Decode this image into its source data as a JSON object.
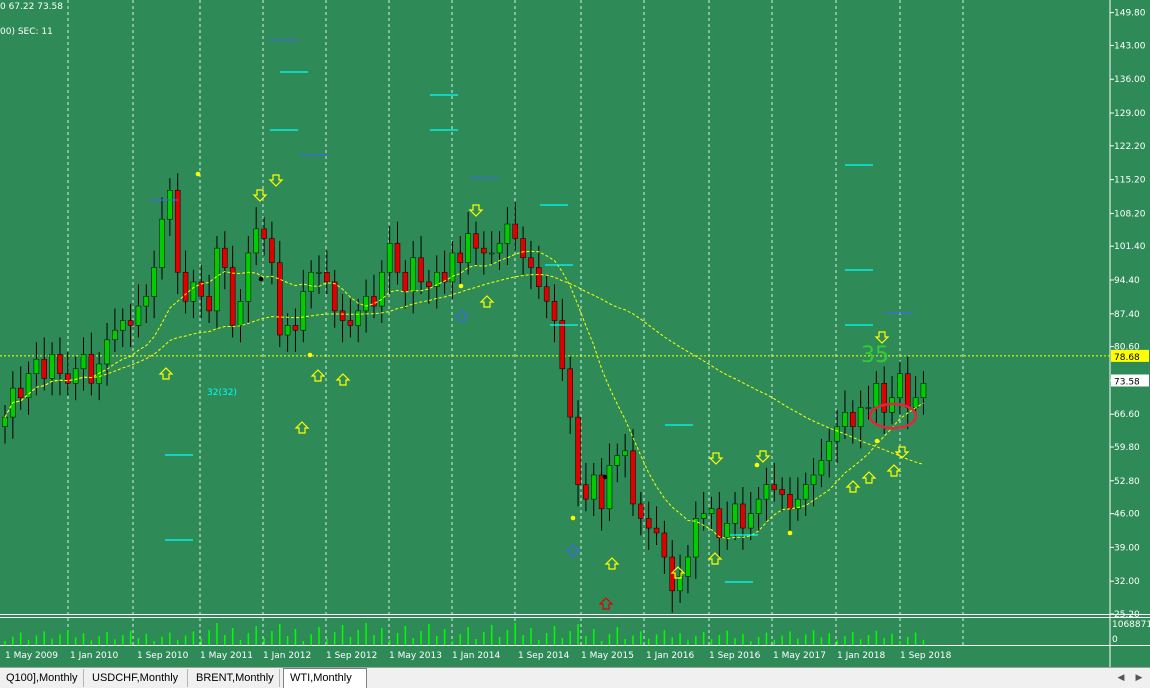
{
  "header": {
    "line1": "0 67.22 73.58",
    "line2": "00)  SEC: 11"
  },
  "price_axis": {
    "ticks": [
      "149.80",
      "143.00",
      "136.00",
      "129.00",
      "122.20",
      "115.20",
      "108.20",
      "101.40",
      "94.40",
      "87.40",
      "80.60",
      "73.58",
      "66.60",
      "59.80",
      "52.80",
      "46.00",
      "39.00",
      "32.00",
      "25.20"
    ],
    "highlight_price": "78.68",
    "current_price": "73.58"
  },
  "volume_axis": {
    "max_label": "1068871",
    "zero_label": "0"
  },
  "time_axis": {
    "labels": [
      "1 May 2009",
      "1 Jan 2010",
      "1 Sep 2010",
      "1 May 2011",
      "1 Jan 2012",
      "1 Sep 2012",
      "1 May 2013",
      "1 Jan 2014",
      "1 Sep 2014",
      "1 May 2015",
      "1 Jan 2016",
      "1 Sep 2016",
      "1 May 2017",
      "1 Jan 2018",
      "1 Sep 2018"
    ]
  },
  "annotations": {
    "count_big": "35",
    "count_small": "32(32)"
  },
  "tabs": [
    {
      "label": "Q100],Monthly",
      "active": false
    },
    {
      "label": "USDCHF,Monthly",
      "active": false
    },
    {
      "label": "BRENT,Monthly",
      "active": false
    },
    {
      "label": "WTI,Monthly",
      "active": true
    }
  ],
  "colors": {
    "background": "#2e8b57",
    "bull_candle": "#00cc00",
    "bear_candle": "#e00000",
    "highlight_label": "#ffff00",
    "current_label": "#ffffff"
  },
  "chart_data": {
    "type": "candlestick",
    "symbol": "WTI",
    "timeframe": "Monthly",
    "ylim": [
      25.2,
      152
    ],
    "current_price": 73.58,
    "highlight_level": 78.68,
    "closes": [
      66,
      72,
      70,
      75,
      78,
      74,
      79,
      75,
      73,
      76,
      79,
      73,
      77,
      82,
      84,
      86,
      85,
      89,
      91,
      97,
      107,
      113,
      96,
      90,
      94,
      91,
      88,
      101,
      97,
      85,
      90,
      100,
      105,
      103,
      98,
      83,
      85,
      84,
      92,
      96,
      96,
      94,
      88,
      86,
      85,
      88,
      91,
      89,
      96,
      102,
      96,
      92,
      99,
      94,
      93,
      96,
      94,
      100,
      98,
      104,
      101,
      100,
      100,
      102,
      106,
      103,
      99,
      97,
      93,
      90,
      86,
      76,
      66,
      52,
      49,
      54,
      47,
      56,
      58,
      59,
      48,
      45,
      43,
      42,
      37,
      30,
      33,
      37,
      45,
      46,
      47,
      41,
      44,
      48,
      43,
      46,
      49,
      52,
      51,
      50,
      47,
      49,
      52,
      54,
      57,
      61,
      64,
      67,
      64,
      68,
      68,
      73,
      67,
      70,
      75,
      68,
      70,
      73
    ]
  }
}
